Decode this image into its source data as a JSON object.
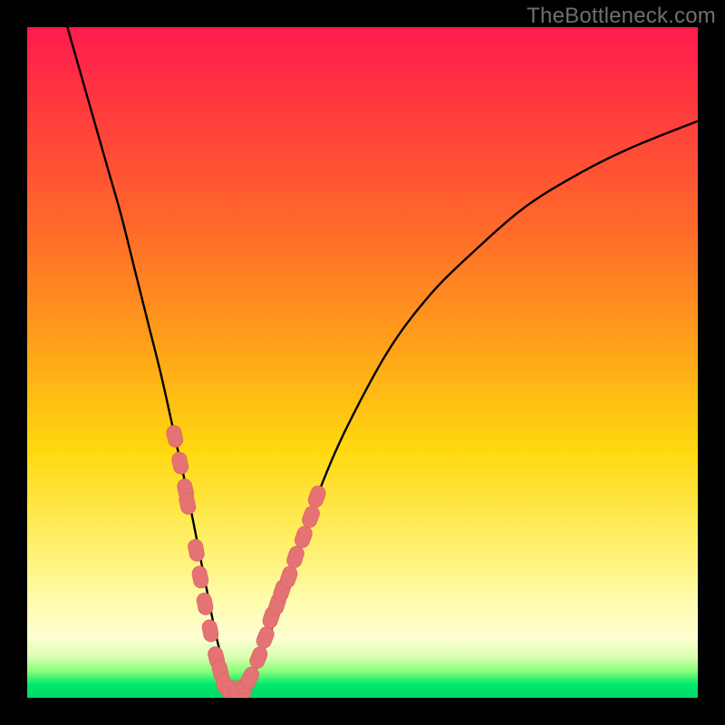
{
  "watermark": {
    "text": "TheBottleneck.com"
  },
  "chart_data": {
    "type": "line",
    "title": "",
    "xlabel": "",
    "ylabel": "",
    "xlim": [
      0,
      100
    ],
    "ylim": [
      0,
      100
    ],
    "series": [
      {
        "name": "bottleneck-curve",
        "x": [
          6,
          8,
          10,
          12,
          14,
          16,
          18,
          20,
          22,
          24,
          26,
          27,
          28,
          29,
          30,
          31,
          32,
          33,
          34,
          36,
          38,
          40,
          44,
          48,
          54,
          60,
          66,
          74,
          82,
          90,
          100
        ],
        "y": [
          100,
          93,
          86,
          79,
          72,
          64,
          56,
          48,
          39,
          30,
          20,
          15,
          10,
          6,
          3,
          1,
          1,
          2,
          4,
          9,
          15,
          21,
          32,
          41,
          52,
          60,
          66,
          73,
          78,
          82,
          86
        ]
      }
    ],
    "marker_clusters": [
      {
        "name": "left-branch-markers",
        "x": [
          22.0,
          22.8,
          23.6,
          23.9,
          25.2,
          25.8,
          26.5,
          27.3,
          28.2,
          28.8
        ],
        "y": [
          39,
          35,
          31,
          29,
          22,
          18,
          14,
          10,
          6,
          4
        ]
      },
      {
        "name": "trough-markers",
        "x": [
          29.4,
          30.2,
          31.0,
          31.8,
          32.6
        ],
        "y": [
          2,
          1,
          1,
          1,
          2
        ]
      },
      {
        "name": "right-branch-markers",
        "x": [
          33.2,
          34.5,
          35.5,
          36.4,
          37.3,
          38.0,
          39.0,
          40.0,
          41.2,
          42.3,
          43.2
        ],
        "y": [
          3,
          6,
          9,
          12,
          14,
          16,
          18,
          21,
          24,
          27,
          30
        ]
      }
    ],
    "colors": {
      "curve": "#000000",
      "marker_fill": "#e57373",
      "marker_stroke": "#e06868"
    }
  }
}
